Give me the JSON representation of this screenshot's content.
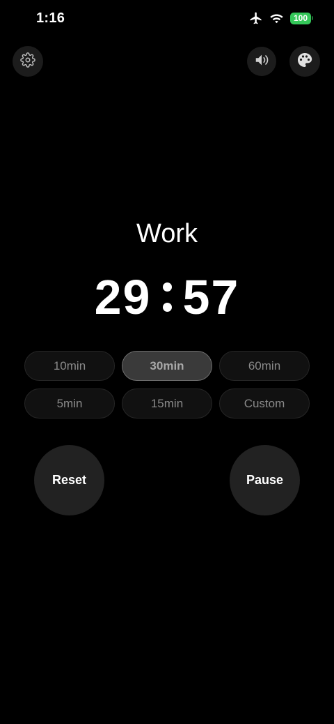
{
  "status_bar": {
    "time": "1:16",
    "battery_level": "100",
    "icons": [
      "airplane-icon",
      "wifi-icon",
      "battery-icon"
    ]
  },
  "top_bar": {
    "icons": [
      "gear-icon",
      "speaker-icon",
      "palette-icon"
    ]
  },
  "mode": {
    "label": "Work"
  },
  "timer": {
    "minutes": "29",
    "seconds": "57"
  },
  "presets": [
    {
      "label": "10min",
      "selected": false
    },
    {
      "label": "30min",
      "selected": true
    },
    {
      "label": "60min",
      "selected": false
    },
    {
      "label": "5min",
      "selected": false
    },
    {
      "label": "15min",
      "selected": false
    },
    {
      "label": "Custom",
      "selected": false
    }
  ],
  "controls": {
    "reset_label": "Reset",
    "pause_label": "Pause"
  },
  "colors": {
    "background": "#000000",
    "battery": "#34c759",
    "button": "#222222",
    "preset_selected": "#3a3a3a"
  }
}
